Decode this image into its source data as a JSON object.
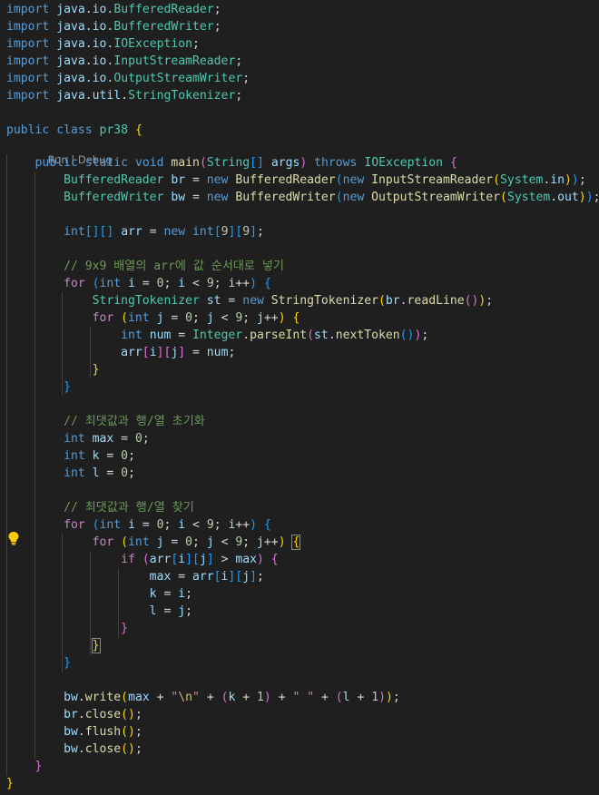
{
  "lines": [
    [
      [
        "k",
        "import"
      ],
      [
        "o",
        " "
      ],
      [
        "v",
        "java"
      ],
      [
        "o",
        "."
      ],
      [
        "v",
        "io"
      ],
      [
        "o",
        "."
      ],
      [
        "t",
        "BufferedReader"
      ],
      [
        "o",
        ";"
      ]
    ],
    [
      [
        "k",
        "import"
      ],
      [
        "o",
        " "
      ],
      [
        "v",
        "java"
      ],
      [
        "o",
        "."
      ],
      [
        "v",
        "io"
      ],
      [
        "o",
        "."
      ],
      [
        "t",
        "BufferedWriter"
      ],
      [
        "o",
        ";"
      ]
    ],
    [
      [
        "k",
        "import"
      ],
      [
        "o",
        " "
      ],
      [
        "v",
        "java"
      ],
      [
        "o",
        "."
      ],
      [
        "v",
        "io"
      ],
      [
        "o",
        "."
      ],
      [
        "t",
        "IOException"
      ],
      [
        "o",
        ";"
      ]
    ],
    [
      [
        "k",
        "import"
      ],
      [
        "o",
        " "
      ],
      [
        "v",
        "java"
      ],
      [
        "o",
        "."
      ],
      [
        "v",
        "io"
      ],
      [
        "o",
        "."
      ],
      [
        "t",
        "InputStreamReader"
      ],
      [
        "o",
        ";"
      ]
    ],
    [
      [
        "k",
        "import"
      ],
      [
        "o",
        " "
      ],
      [
        "v",
        "java"
      ],
      [
        "o",
        "."
      ],
      [
        "v",
        "io"
      ],
      [
        "o",
        "."
      ],
      [
        "t",
        "OutputStreamWriter"
      ],
      [
        "o",
        ";"
      ]
    ],
    [
      [
        "k",
        "import"
      ],
      [
        "o",
        " "
      ],
      [
        "v",
        "java"
      ],
      [
        "o",
        "."
      ],
      [
        "v",
        "util"
      ],
      [
        "o",
        "."
      ],
      [
        "t",
        "StringTokenizer"
      ],
      [
        "o",
        ";"
      ]
    ],
    [],
    [
      [
        "k",
        "public"
      ],
      [
        "o",
        " "
      ],
      [
        "k",
        "class"
      ],
      [
        "o",
        " "
      ],
      [
        "t",
        "pr38"
      ],
      [
        "o",
        " "
      ],
      [
        "b1",
        "{"
      ]
    ],
    [
      [
        "o",
        "    "
      ],
      [
        "k",
        "public"
      ],
      [
        "o",
        " "
      ],
      [
        "k",
        "static"
      ],
      [
        "o",
        " "
      ],
      [
        "k",
        "void"
      ],
      [
        "o",
        " "
      ],
      [
        "f",
        "main"
      ],
      [
        "b2",
        "("
      ],
      [
        "t",
        "String"
      ],
      [
        "b3",
        "[]"
      ],
      [
        "o",
        " "
      ],
      [
        "v",
        "args"
      ],
      [
        "b2",
        ")"
      ],
      [
        "o",
        " "
      ],
      [
        "k",
        "throws"
      ],
      [
        "o",
        " "
      ],
      [
        "t",
        "IOException"
      ],
      [
        "o",
        " "
      ],
      [
        "b2",
        "{"
      ]
    ],
    [
      [
        "o",
        "        "
      ],
      [
        "t",
        "BufferedReader"
      ],
      [
        "o",
        " "
      ],
      [
        "v",
        "br"
      ],
      [
        "o",
        " = "
      ],
      [
        "k",
        "new"
      ],
      [
        "o",
        " "
      ],
      [
        "f",
        "BufferedReader"
      ],
      [
        "b3",
        "("
      ],
      [
        "k",
        "new"
      ],
      [
        "o",
        " "
      ],
      [
        "f",
        "InputStreamReader"
      ],
      [
        "b1",
        "("
      ],
      [
        "t",
        "System"
      ],
      [
        "o",
        "."
      ],
      [
        "v",
        "in"
      ],
      [
        "b1",
        ")"
      ],
      [
        "b3",
        ")"
      ],
      [
        "o",
        ";"
      ]
    ],
    [
      [
        "o",
        "        "
      ],
      [
        "t",
        "BufferedWriter"
      ],
      [
        "o",
        " "
      ],
      [
        "v",
        "bw"
      ],
      [
        "o",
        " = "
      ],
      [
        "k",
        "new"
      ],
      [
        "o",
        " "
      ],
      [
        "f",
        "BufferedWriter"
      ],
      [
        "b3",
        "("
      ],
      [
        "k",
        "new"
      ],
      [
        "o",
        " "
      ],
      [
        "f",
        "OutputStreamWriter"
      ],
      [
        "b1",
        "("
      ],
      [
        "t",
        "System"
      ],
      [
        "o",
        "."
      ],
      [
        "v",
        "out"
      ],
      [
        "b1",
        ")"
      ],
      [
        "b3",
        ")"
      ],
      [
        "o",
        ";"
      ]
    ],
    [],
    [
      [
        "o",
        "        "
      ],
      [
        "k",
        "int"
      ],
      [
        "b3",
        "[]"
      ],
      [
        "b3",
        "[]"
      ],
      [
        "o",
        " "
      ],
      [
        "v",
        "arr"
      ],
      [
        "o",
        " = "
      ],
      [
        "k",
        "new"
      ],
      [
        "o",
        " "
      ],
      [
        "k",
        "int"
      ],
      [
        "b3",
        "["
      ],
      [
        "n",
        "9"
      ],
      [
        "b3",
        "]"
      ],
      [
        "b3",
        "["
      ],
      [
        "n",
        "9"
      ],
      [
        "b3",
        "]"
      ],
      [
        "o",
        ";"
      ]
    ],
    [],
    [
      [
        "o",
        "        "
      ],
      [
        "cm",
        "// 9x9 배열의 arr에 값 순서대로 넣기"
      ]
    ],
    [
      [
        "o",
        "        "
      ],
      [
        "c",
        "for"
      ],
      [
        "o",
        " "
      ],
      [
        "b3",
        "("
      ],
      [
        "k",
        "int"
      ],
      [
        "o",
        " "
      ],
      [
        "v",
        "i"
      ],
      [
        "o",
        " = "
      ],
      [
        "n",
        "0"
      ],
      [
        "o",
        "; "
      ],
      [
        "v",
        "i"
      ],
      [
        "o",
        " < "
      ],
      [
        "n",
        "9"
      ],
      [
        "o",
        "; "
      ],
      [
        "v",
        "i"
      ],
      [
        "o",
        "++"
      ],
      [
        "b3",
        ")"
      ],
      [
        "o",
        " "
      ],
      [
        "b3",
        "{"
      ]
    ],
    [
      [
        "o",
        "            "
      ],
      [
        "t",
        "StringTokenizer"
      ],
      [
        "o",
        " "
      ],
      [
        "v",
        "st"
      ],
      [
        "o",
        " = "
      ],
      [
        "k",
        "new"
      ],
      [
        "o",
        " "
      ],
      [
        "f",
        "StringTokenizer"
      ],
      [
        "b1",
        "("
      ],
      [
        "v",
        "br"
      ],
      [
        "o",
        "."
      ],
      [
        "f",
        "readLine"
      ],
      [
        "b2",
        "()"
      ],
      [
        "b1",
        ")"
      ],
      [
        "o",
        ";"
      ]
    ],
    [
      [
        "o",
        "            "
      ],
      [
        "c",
        "for"
      ],
      [
        "o",
        " "
      ],
      [
        "b1",
        "("
      ],
      [
        "k",
        "int"
      ],
      [
        "o",
        " "
      ],
      [
        "v",
        "j"
      ],
      [
        "o",
        " = "
      ],
      [
        "n",
        "0"
      ],
      [
        "o",
        "; "
      ],
      [
        "v",
        "j"
      ],
      [
        "o",
        " < "
      ],
      [
        "n",
        "9"
      ],
      [
        "o",
        "; "
      ],
      [
        "v",
        "j"
      ],
      [
        "o",
        "++"
      ],
      [
        "b1",
        ")"
      ],
      [
        "o",
        " "
      ],
      [
        "b1",
        "{"
      ]
    ],
    [
      [
        "o",
        "                "
      ],
      [
        "k",
        "int"
      ],
      [
        "o",
        " "
      ],
      [
        "v",
        "num"
      ],
      [
        "o",
        " = "
      ],
      [
        "t",
        "Integer"
      ],
      [
        "o",
        "."
      ],
      [
        "f",
        "parseInt"
      ],
      [
        "b2",
        "("
      ],
      [
        "v",
        "st"
      ],
      [
        "o",
        "."
      ],
      [
        "f",
        "nextToken"
      ],
      [
        "b3",
        "()"
      ],
      [
        "b2",
        ")"
      ],
      [
        "o",
        ";"
      ]
    ],
    [
      [
        "o",
        "                "
      ],
      [
        "v",
        "arr"
      ],
      [
        "b2",
        "["
      ],
      [
        "v",
        "i"
      ],
      [
        "b2",
        "]"
      ],
      [
        "b2",
        "["
      ],
      [
        "v",
        "j"
      ],
      [
        "b2",
        "]"
      ],
      [
        "o",
        " = "
      ],
      [
        "v",
        "num"
      ],
      [
        "o",
        ";"
      ]
    ],
    [
      [
        "o",
        "            "
      ],
      [
        "b1",
        "}"
      ]
    ],
    [
      [
        "o",
        "        "
      ],
      [
        "b3",
        "}"
      ]
    ],
    [],
    [
      [
        "o",
        "        "
      ],
      [
        "cm",
        "// 최댓값과 행/열 초기화"
      ]
    ],
    [
      [
        "o",
        "        "
      ],
      [
        "k",
        "int"
      ],
      [
        "o",
        " "
      ],
      [
        "v",
        "max"
      ],
      [
        "o",
        " = "
      ],
      [
        "n",
        "0"
      ],
      [
        "o",
        ";"
      ]
    ],
    [
      [
        "o",
        "        "
      ],
      [
        "k",
        "int"
      ],
      [
        "o",
        " "
      ],
      [
        "v",
        "k"
      ],
      [
        "o",
        " = "
      ],
      [
        "n",
        "0"
      ],
      [
        "o",
        ";"
      ]
    ],
    [
      [
        "o",
        "        "
      ],
      [
        "k",
        "int"
      ],
      [
        "o",
        " "
      ],
      [
        "v",
        "l"
      ],
      [
        "o",
        " = "
      ],
      [
        "n",
        "0"
      ],
      [
        "o",
        ";"
      ]
    ],
    [],
    [
      [
        "o",
        "        "
      ],
      [
        "cm",
        "// 최댓값과 행/열 찾기"
      ]
    ],
    [
      [
        "o",
        "        "
      ],
      [
        "c",
        "for"
      ],
      [
        "o",
        " "
      ],
      [
        "b3",
        "("
      ],
      [
        "k",
        "int"
      ],
      [
        "o",
        " "
      ],
      [
        "v",
        "i"
      ],
      [
        "o",
        " = "
      ],
      [
        "n",
        "0"
      ],
      [
        "o",
        "; "
      ],
      [
        "v",
        "i"
      ],
      [
        "o",
        " < "
      ],
      [
        "n",
        "9"
      ],
      [
        "o",
        "; "
      ],
      [
        "v",
        "i"
      ],
      [
        "o",
        "++"
      ],
      [
        "b3",
        ")"
      ],
      [
        "o",
        " "
      ],
      [
        "b3",
        "{"
      ]
    ],
    [
      [
        "o",
        "            "
      ],
      [
        "c",
        "for"
      ],
      [
        "o",
        " "
      ],
      [
        "b1",
        "("
      ],
      [
        "k",
        "int"
      ],
      [
        "o",
        " "
      ],
      [
        "v",
        "j"
      ],
      [
        "o",
        " = "
      ],
      [
        "n",
        "0"
      ],
      [
        "o",
        "; "
      ],
      [
        "v",
        "j"
      ],
      [
        "o",
        " < "
      ],
      [
        "n",
        "9"
      ],
      [
        "o",
        "; "
      ],
      [
        "v",
        "j"
      ],
      [
        "o",
        "++"
      ],
      [
        "b1",
        ")"
      ],
      [
        "o",
        " "
      ],
      [
        "b1 sel",
        "{"
      ]
    ],
    [
      [
        "o",
        "                "
      ],
      [
        "c",
        "if"
      ],
      [
        "o",
        " "
      ],
      [
        "b2",
        "("
      ],
      [
        "v",
        "arr"
      ],
      [
        "b3",
        "["
      ],
      [
        "v",
        "i"
      ],
      [
        "b3",
        "]"
      ],
      [
        "b3",
        "["
      ],
      [
        "v",
        "j"
      ],
      [
        "b3",
        "]"
      ],
      [
        "o",
        " > "
      ],
      [
        "v",
        "max"
      ],
      [
        "b2",
        ")"
      ],
      [
        "o",
        " "
      ],
      [
        "b2",
        "{"
      ]
    ],
    [
      [
        "o",
        "                    "
      ],
      [
        "v",
        "max"
      ],
      [
        "o",
        " = "
      ],
      [
        "v",
        "arr"
      ],
      [
        "b3",
        "["
      ],
      [
        "v",
        "i"
      ],
      [
        "b3",
        "]"
      ],
      [
        "b3",
        "["
      ],
      [
        "v",
        "j"
      ],
      [
        "b3",
        "]"
      ],
      [
        "o",
        ";"
      ]
    ],
    [
      [
        "o",
        "                    "
      ],
      [
        "v",
        "k"
      ],
      [
        "o",
        " = "
      ],
      [
        "v",
        "i"
      ],
      [
        "o",
        ";"
      ]
    ],
    [
      [
        "o",
        "                    "
      ],
      [
        "v",
        "l"
      ],
      [
        "o",
        " = "
      ],
      [
        "v",
        "j"
      ],
      [
        "o",
        ";"
      ]
    ],
    [
      [
        "o",
        "                "
      ],
      [
        "b2",
        "}"
      ]
    ],
    [
      [
        "o",
        "            "
      ],
      [
        "b1 sel",
        "}"
      ]
    ],
    [
      [
        "o",
        "        "
      ],
      [
        "b3",
        "}"
      ]
    ],
    [],
    [
      [
        "o",
        "        "
      ],
      [
        "v",
        "bw"
      ],
      [
        "o",
        "."
      ],
      [
        "f",
        "write"
      ],
      [
        "b1",
        "("
      ],
      [
        "v",
        "max"
      ],
      [
        "o",
        " + "
      ],
      [
        "s",
        "\""
      ],
      [
        "e",
        "\\n"
      ],
      [
        "s",
        "\""
      ],
      [
        "o",
        " + "
      ],
      [
        "b2",
        "("
      ],
      [
        "v",
        "k"
      ],
      [
        "o",
        " + "
      ],
      [
        "n",
        "1"
      ],
      [
        "b2",
        ")"
      ],
      [
        "o",
        " + "
      ],
      [
        "s",
        "\" \""
      ],
      [
        "o",
        " + "
      ],
      [
        "b2",
        "("
      ],
      [
        "v",
        "l"
      ],
      [
        "o",
        " + "
      ],
      [
        "n",
        "1"
      ],
      [
        "b2",
        ")"
      ],
      [
        "b1",
        ")"
      ],
      [
        "o",
        ";"
      ]
    ],
    [
      [
        "o",
        "        "
      ],
      [
        "v",
        "br"
      ],
      [
        "o",
        "."
      ],
      [
        "f",
        "close"
      ],
      [
        "b1",
        "()"
      ],
      [
        "o",
        ";"
      ]
    ],
    [
      [
        "o",
        "        "
      ],
      [
        "v",
        "bw"
      ],
      [
        "o",
        "."
      ],
      [
        "f",
        "flush"
      ],
      [
        "b1",
        "()"
      ],
      [
        "o",
        ";"
      ]
    ],
    [
      [
        "o",
        "        "
      ],
      [
        "v",
        "bw"
      ],
      [
        "o",
        "."
      ],
      [
        "f",
        "close"
      ],
      [
        "b1",
        "()"
      ],
      [
        "o",
        ";"
      ]
    ],
    [
      [
        "o",
        "    "
      ],
      [
        "b2",
        "}"
      ]
    ],
    [
      [
        "b1",
        "}"
      ]
    ]
  ],
  "codelens": {
    "run": "Run",
    "separator": " | ",
    "debug": "Debug"
  }
}
